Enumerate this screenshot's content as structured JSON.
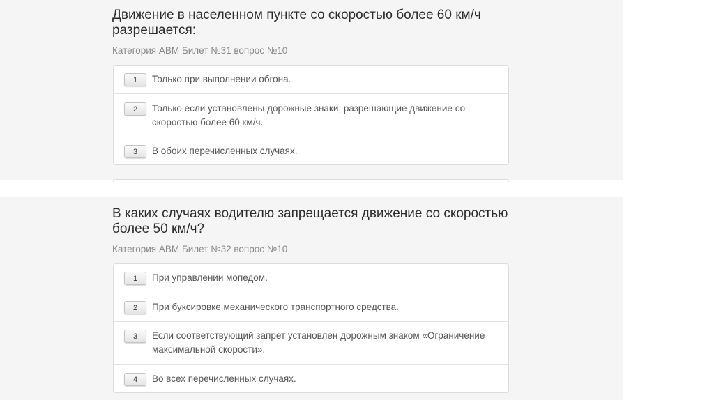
{
  "questions": [
    {
      "title": "Движение в населенном пункте со скоростью более 60 км/ч разрешается:",
      "meta": "Категория ABM  Билет №31  вопрос №10",
      "answers": [
        {
          "num": "1",
          "text": "Только при выполнении обгона."
        },
        {
          "num": "2",
          "text": "Только если установлены дорожные знаки, разрешающие движение со скоростью более 60 км/ч."
        },
        {
          "num": "3",
          "text": "В обоих перечисленных случаях."
        }
      ]
    },
    {
      "title": "В каких случаях водителю запрещается движение со скоростью более 50 км/ч?",
      "meta": "Категория ABM  Билет №32  вопрос №10",
      "answers": [
        {
          "num": "1",
          "text": "При управлении мопедом."
        },
        {
          "num": "2",
          "text": "При буксировке механического транспортного средства."
        },
        {
          "num": "3",
          "text": "Если соответствующий запрет установлен дорожным знаком «Ограничение максимальной скорости»."
        },
        {
          "num": "4",
          "text": "Во всех перечисленных случаях."
        }
      ]
    }
  ]
}
